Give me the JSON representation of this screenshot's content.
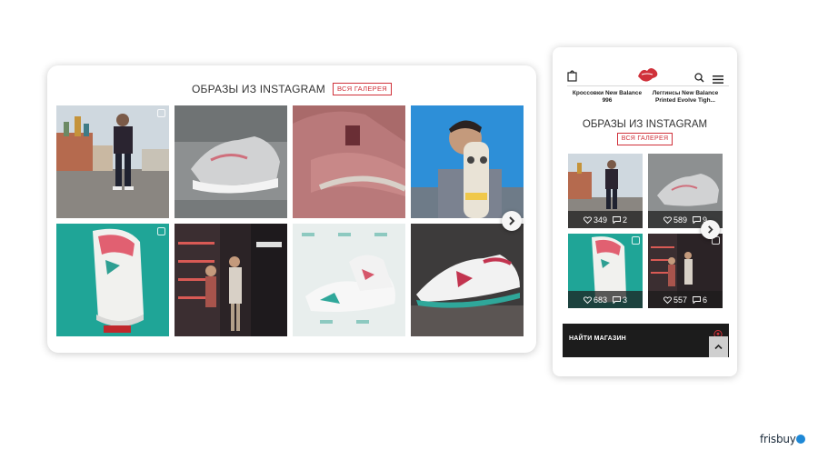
{
  "desktop": {
    "title": "ОБРАЗЫ ИЗ INSTAGRAM",
    "gallery_button": "ВСЯ ГАЛЕРЕЯ"
  },
  "mobile": {
    "products": [
      {
        "name": "Кроссовки New Balance 996"
      },
      {
        "name": "Леггинсы New Balance Printed Evolve Tigh..."
      }
    ],
    "title": "ОБРАЗЫ ИЗ INSTAGRAM",
    "gallery_button": "ВСЯ ГАЛЕРЕЯ",
    "posts": [
      {
        "likes": "349",
        "comments": "2"
      },
      {
        "likes": "589",
        "comments": "9"
      },
      {
        "likes": "683",
        "comments": "3"
      },
      {
        "likes": "557",
        "comments": "6"
      }
    ],
    "store_bar_label": "НАЙТИ МАГАЗИН"
  },
  "icons": {
    "next_arrow": "chevron-right-icon",
    "scroll_up": "chevron-up-icon",
    "bag": "shopping-bag-icon",
    "search": "search-icon",
    "menu": "hamburger-menu-icon",
    "like": "heart-icon",
    "comment": "comment-icon",
    "location": "map-pin-icon"
  },
  "brand": {
    "name": "frisbuy",
    "accent_color": "#1e88d6"
  },
  "colors": {
    "accent": "#d0313a",
    "dark_bar": "#1c1c1c"
  }
}
